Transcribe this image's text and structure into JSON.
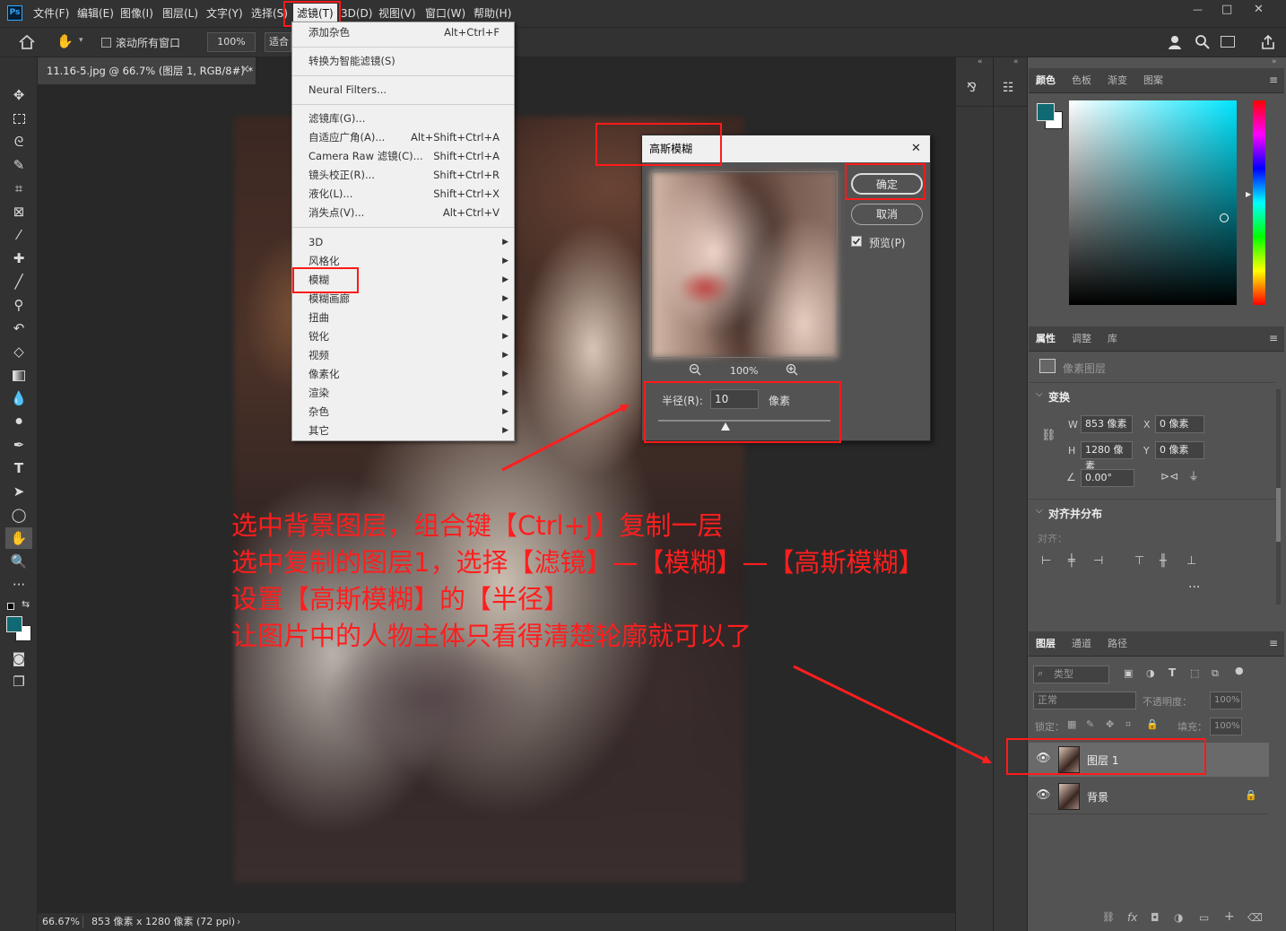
{
  "menubar": {
    "ps_logo": "Ps",
    "items": [
      "文件(F)",
      "编辑(E)",
      "图像(I)",
      "图层(L)",
      "文字(Y)",
      "选择(S)",
      "滤镜(T)",
      "3D(D)",
      "视图(V)",
      "窗口(W)",
      "帮助(H)"
    ]
  },
  "optionsbar": {
    "scroll_all_label": "滚动所有窗口",
    "zoom_value": "100%",
    "fit_label": "适合"
  },
  "doc_tab": {
    "title": "11.16-5.jpg @ 66.7% (图层 1, RGB/8#) *",
    "close": "×"
  },
  "status": {
    "zoom": "66.67%",
    "size": "853 像素 x 1280 像素 (72 ppi)",
    "arrow": "›"
  },
  "filter_menu": {
    "items": [
      {
        "label": "添加杂色",
        "shortcut": "Alt+Ctrl+F"
      },
      {
        "label": "转换为智能滤镜(S)",
        "shortcut": ""
      },
      {
        "label": "Neural Filters...",
        "shortcut": ""
      },
      {
        "label": "滤镜库(G)...",
        "shortcut": ""
      },
      {
        "label": "自适应广角(A)...",
        "shortcut": "Alt+Shift+Ctrl+A"
      },
      {
        "label": "Camera Raw 滤镜(C)...",
        "shortcut": "Shift+Ctrl+A"
      },
      {
        "label": "镜头校正(R)...",
        "shortcut": "Shift+Ctrl+R"
      },
      {
        "label": "液化(L)...",
        "shortcut": "Shift+Ctrl+X"
      },
      {
        "label": "消失点(V)...",
        "shortcut": "Alt+Ctrl+V"
      }
    ],
    "submenus": [
      "3D",
      "风格化",
      "模糊",
      "模糊画廊",
      "扭曲",
      "锐化",
      "视频",
      "像素化",
      "渲染",
      "杂色",
      "其它"
    ],
    "arrow": "▶"
  },
  "gaussian_dialog": {
    "title": "高斯模糊",
    "close": "✕",
    "ok": "确定",
    "cancel": "取消",
    "preview_label": "预览(P)",
    "zoom": "100%",
    "radius_label": "半径(R):",
    "radius_value": "10",
    "unit": "像素",
    "zoom_out": "−",
    "zoom_in": "+"
  },
  "annotation": {
    "lines": [
      "选中背景图层，组合键【Ctrl+J】复制一层",
      "选中复制的图层1，选择【滤镜】—【模糊】—【高斯模糊】",
      "设置【高斯模糊】的【半径】",
      "让图片中的人物主体只看得清楚轮廓就可以了"
    ]
  },
  "color_panel": {
    "tabs": [
      "颜色",
      "色板",
      "渐变",
      "图案"
    ],
    "fg_color": "#0f6a73",
    "bg_color": "#ffffff",
    "hue_color": "#00e5ff"
  },
  "properties_panel": {
    "tabs": [
      "属性",
      "调整",
      "库"
    ],
    "layer_type": "像素图层",
    "transform": "变换",
    "w_label": "W",
    "w_value": "853 像素",
    "x_label": "X",
    "x_value": "0 像素",
    "h_label": "H",
    "h_value": "1280 像素",
    "y_label": "Y",
    "y_value": "0 像素",
    "angle_value": "0.00°",
    "align_title": "对齐并分布",
    "align_label": "对齐：",
    "more": "···"
  },
  "layers_panel": {
    "tabs": [
      "图层",
      "通道",
      "路径"
    ],
    "filter_label": "类型",
    "blend_mode": "正常",
    "opacity_label": "不透明度：",
    "opacity_value": "100%",
    "lock_label": "锁定：",
    "fill_label": "填充：",
    "fill_value": "100%",
    "layers": [
      {
        "name": "图层 1",
        "selected": true
      },
      {
        "name": "背景",
        "selected": false
      }
    ],
    "footer_icons": [
      "GO",
      "fx",
      "◘",
      "◑",
      "▭",
      "+",
      "🗑"
    ]
  },
  "colors": {
    "accent": "#ff1e1e",
    "bg_dark": "#323232",
    "canvas": "#282828",
    "panel": "#535353"
  },
  "window_controls": {
    "min": "—",
    "max": "□",
    "close": "✕"
  }
}
